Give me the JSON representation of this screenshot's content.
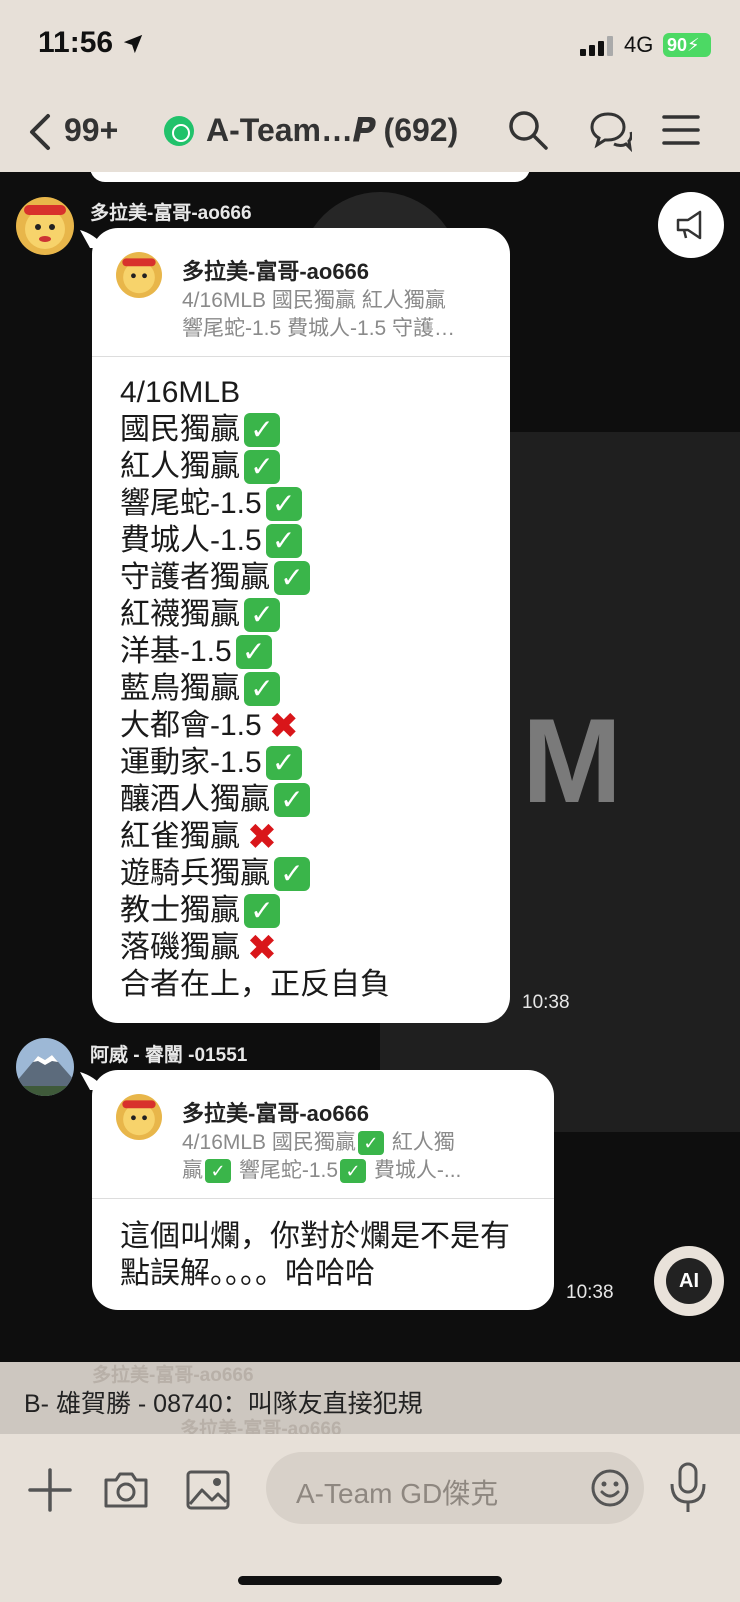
{
  "status": {
    "time": "11:56",
    "network": "4G",
    "battery": "90"
  },
  "header": {
    "back_count": "99+",
    "title": "A-Team…𝑷 (692)"
  },
  "messages": [
    {
      "sender": "多拉美-富哥-ao666",
      "quote": {
        "name": "多拉美-富哥-ao666",
        "line1": "4/16MLB 國民獨贏 紅人獨贏",
        "line2": "響尾蛇-1.5 費城人-1.5 守護…"
      },
      "lines": [
        {
          "text": "4/16MLB",
          "mark": ""
        },
        {
          "text": "國民獨贏",
          "mark": "check"
        },
        {
          "text": "紅人獨贏",
          "mark": "check"
        },
        {
          "text": "響尾蛇-1.5",
          "mark": "check"
        },
        {
          "text": "費城人-1.5",
          "mark": "check"
        },
        {
          "text": "守護者獨贏",
          "mark": "check"
        },
        {
          "text": "紅襪獨贏",
          "mark": "check"
        },
        {
          "text": "洋基-1.5",
          "mark": "check"
        },
        {
          "text": "藍鳥獨贏",
          "mark": "check"
        },
        {
          "text": "大都會-1.5",
          "mark": "cross"
        },
        {
          "text": "運動家-1.5",
          "mark": "check"
        },
        {
          "text": "釀酒人獨贏",
          "mark": "check"
        },
        {
          "text": "紅雀獨贏",
          "mark": "cross"
        },
        {
          "text": "遊騎兵獨贏",
          "mark": "check"
        },
        {
          "text": "教士獨贏",
          "mark": "check"
        },
        {
          "text": "落磯獨贏",
          "mark": "cross"
        },
        {
          "text": "合者在上，正反自負",
          "mark": ""
        }
      ],
      "time": "10:38"
    },
    {
      "sender": "阿威 - 睿闓 -01551",
      "quote": {
        "name": "多拉美-富哥-ao666",
        "line1a": "4/16MLB 國民獨贏",
        "line1b": " 紅人獨",
        "line2a": "贏",
        "line2b": " 響尾蛇-1.5",
        "line2c": " 費城人-..."
      },
      "line1": "這個叫爛，你對於爛是不是有",
      "line2": "點誤解。。。。哈哈哈",
      "time": "10:38"
    }
  ],
  "ai_label": "AI",
  "notice": {
    "ghost1": "多拉美-富哥-ao666",
    "ghost2": "多拉美-富哥-ao666",
    "text": "B- 雄賀勝 - 08740：叫隊友直接犯規"
  },
  "input": {
    "placeholder": "A-Team GD傑克"
  },
  "colors": {
    "header_bg": "#e7e0d8",
    "chat_bg": "#0e0e0e",
    "check_green": "#3ab54a",
    "cross_red": "#d9161a",
    "battery_green": "#4cd964",
    "group_green": "#21c26b"
  },
  "icons": [
    "location-arrow-icon",
    "signal-icon",
    "back-chevron-icon",
    "group-icon",
    "search-icon",
    "chat-bubbles-icon",
    "menu-icon",
    "announcement-icon",
    "ai-icon",
    "plus-icon",
    "camera-icon",
    "image-icon",
    "smiley-icon",
    "microphone-icon"
  ]
}
